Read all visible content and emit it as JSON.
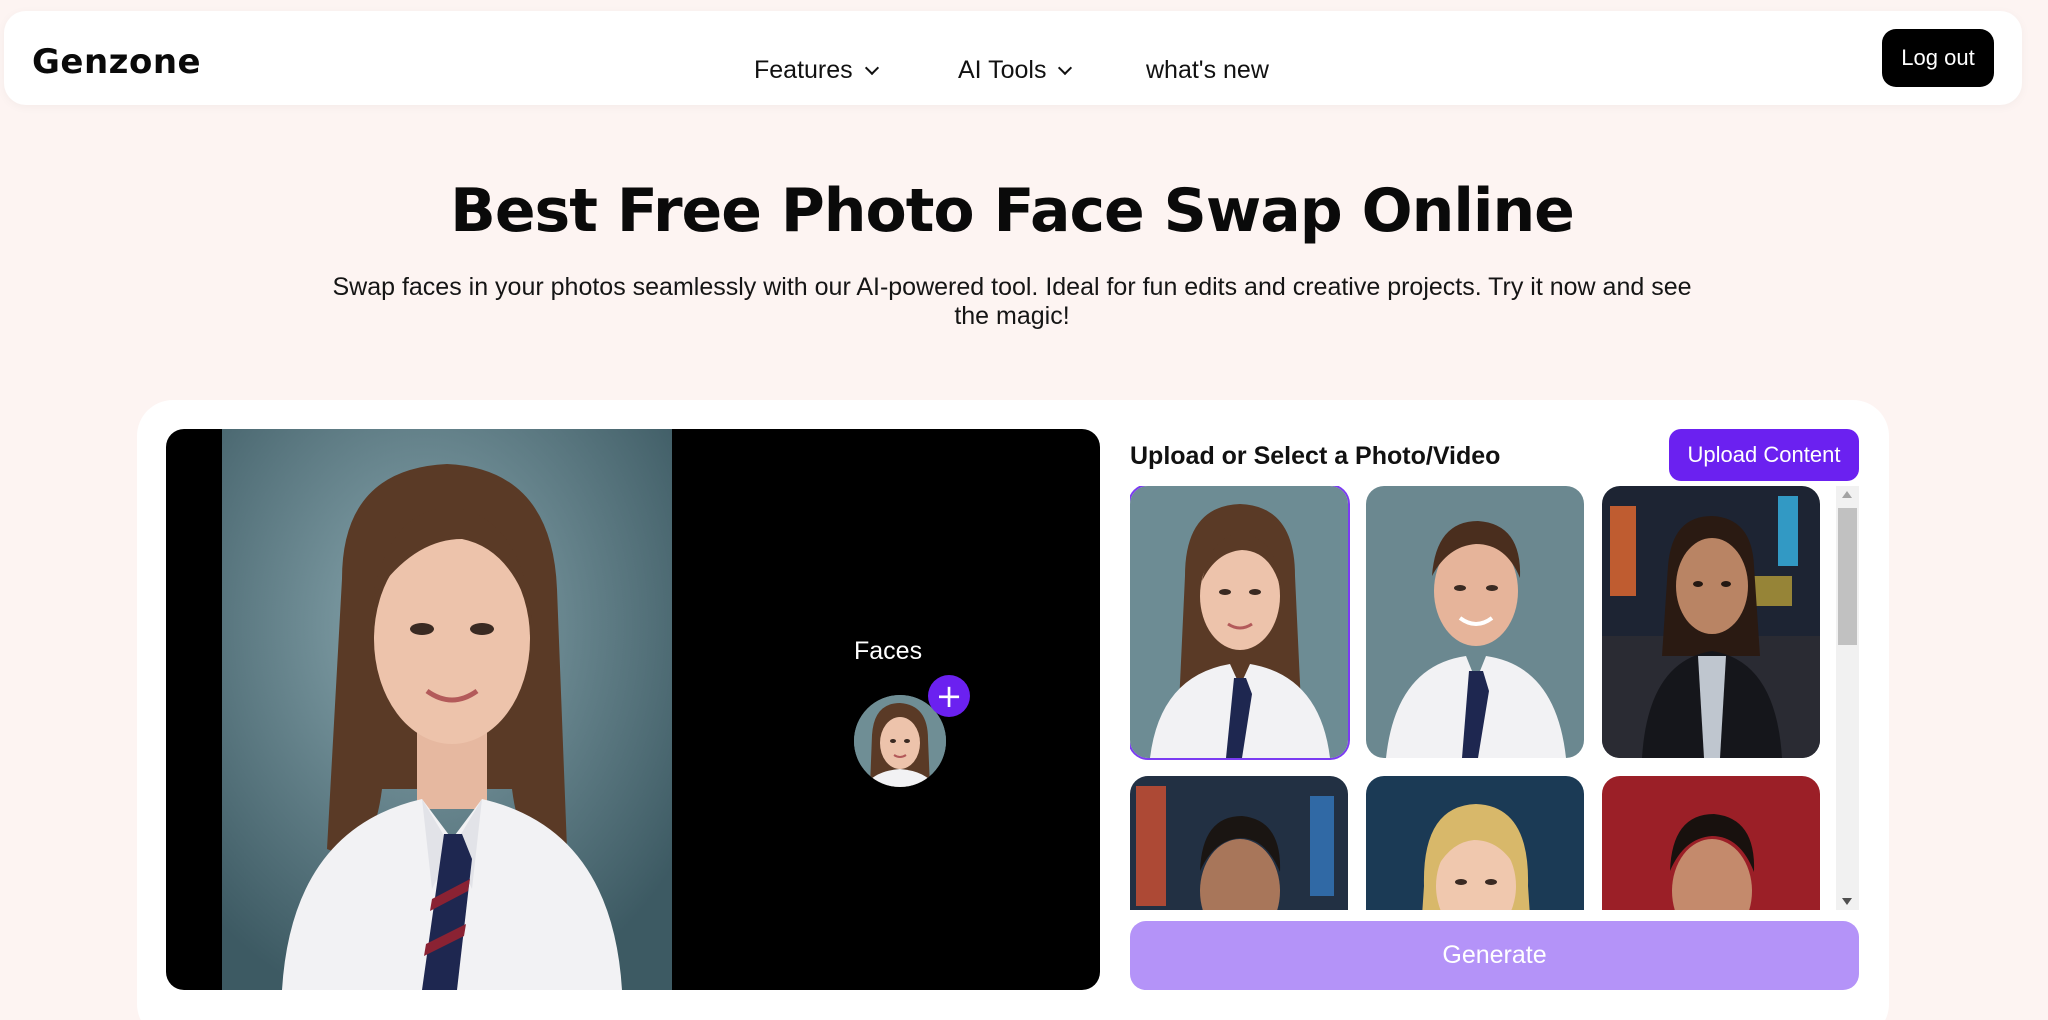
{
  "brand": {
    "logo": "Genzone"
  },
  "nav": {
    "links": [
      {
        "label": "Features",
        "has_dropdown": true
      },
      {
        "label": "AI Tools",
        "has_dropdown": true
      },
      {
        "label": "what's new",
        "has_dropdown": false
      }
    ],
    "logout_label": "Log out"
  },
  "hero": {
    "title": "Best Free Photo Face Swap Online",
    "subtitle": "Swap faces in your photos seamlessly with our AI-powered tool. Ideal for fun edits and creative projects. Try it now and see the magic!"
  },
  "preview": {
    "faces_label": "Faces",
    "add_face_symbol": "+"
  },
  "panel": {
    "title": "Upload or Select a Photo/Video",
    "upload_label": "Upload Content",
    "generate_label": "Generate",
    "selected_index": 0
  },
  "colors": {
    "accent": "#6b21f0",
    "generate_disabled": "#b493f8",
    "page_bg": "#fdf4f2"
  },
  "icons": {
    "dropdown": "chevron-down-icon",
    "add": "plus-icon",
    "scroll_up": "scroll-up-arrow",
    "scroll_down": "scroll-down-arrow"
  }
}
